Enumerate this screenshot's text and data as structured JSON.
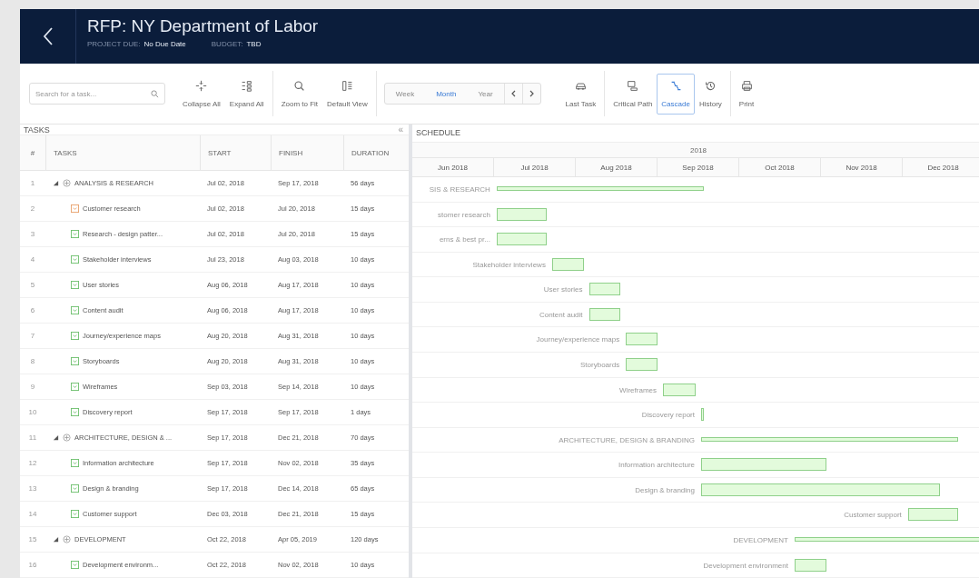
{
  "header": {
    "title": "RFP: NY Department of Labor",
    "fields": [
      {
        "label": "PROJECT DUE:",
        "value": "No Due Date"
      },
      {
        "label": "BUDGET:",
        "value": "TBD"
      }
    ]
  },
  "toolbar": {
    "search": {
      "placeholder": "Search for a task..."
    },
    "left_groups": [
      {
        "buttons": [
          {
            "label": "Collapse All",
            "kind": "collapse",
            "selected": false
          },
          {
            "label": "Expand All",
            "kind": "expand",
            "selected": false
          }
        ]
      },
      {
        "buttons": [
          {
            "label": "Zoom to Fit",
            "kind": "zoom",
            "selected": false
          },
          {
            "label": "Default View",
            "kind": "columns",
            "selected": false
          }
        ]
      }
    ],
    "view_switch": [
      {
        "label": "Week",
        "selected": false
      },
      {
        "label": "Month",
        "selected": true
      },
      {
        "label": "Year",
        "selected": false
      }
    ],
    "right_groups": [
      {
        "buttons": [
          {
            "label": "Last Task",
            "kind": "last",
            "selected": false
          }
        ]
      },
      {
        "buttons": [
          {
            "label": "Critical Path",
            "kind": "critical",
            "selected": false
          },
          {
            "label": "Cascade",
            "kind": "cascade",
            "selected": true
          },
          {
            "label": "History",
            "kind": "history",
            "selected": false
          }
        ]
      },
      {
        "buttons": [
          {
            "label": "Print",
            "kind": "print",
            "selected": false
          }
        ]
      }
    ]
  },
  "tasks": {
    "title": "TASKS",
    "collapse": "«",
    "columns": [
      "#",
      "TASKS",
      "START",
      "FINISH",
      "DURATION"
    ],
    "rows": [
      {
        "number": "1",
        "name": "ANALYSIS & RESEARCH",
        "start": "Jul 02, 2018",
        "finish": "Sep 17, 2018",
        "duration": "56 days",
        "expanded": true,
        "children": [
          {
            "number": "2",
            "name": "Customer research",
            "start": "Jul 02, 2018",
            "finish": "Jul 20, 2018",
            "duration": "15 days",
            "color": "#e8a06a"
          },
          {
            "number": "3",
            "name": "Research - design patter...",
            "start": "Jul 02, 2018",
            "finish": "Jul 20, 2018",
            "duration": "15 days",
            "color": "#6cbf6c"
          },
          {
            "number": "4",
            "name": "Stakeholder interviews",
            "start": "Jul 23, 2018",
            "finish": "Aug 03, 2018",
            "duration": "10 days",
            "color": "#6cbf6c"
          },
          {
            "number": "5",
            "name": "User stories",
            "start": "Aug 06, 2018",
            "finish": "Aug 17, 2018",
            "duration": "10 days",
            "color": "#6cbf6c"
          },
          {
            "number": "6",
            "name": "Content audit",
            "start": "Aug 06, 2018",
            "finish": "Aug 17, 2018",
            "duration": "10 days",
            "color": "#6cbf6c"
          },
          {
            "number": "7",
            "name": "Journey/experience maps",
            "start": "Aug 20, 2018",
            "finish": "Aug 31, 2018",
            "duration": "10 days",
            "color": "#6cbf6c"
          },
          {
            "number": "8",
            "name": "Storyboards",
            "start": "Aug 20, 2018",
            "finish": "Aug 31, 2018",
            "duration": "10 days",
            "color": "#6cbf6c"
          },
          {
            "number": "9",
            "name": "Wireframes",
            "start": "Sep 03, 2018",
            "finish": "Sep 14, 2018",
            "duration": "10 days",
            "color": "#6cbf6c"
          },
          {
            "number": "10",
            "name": "Discovery report",
            "start": "Sep 17, 2018",
            "finish": "Sep 17, 2018",
            "duration": "1 days",
            "color": "#6cbf6c"
          }
        ]
      },
      {
        "number": "11",
        "name": "ARCHITECTURE, DESIGN & ...",
        "start": "Sep 17, 2018",
        "finish": "Dec 21, 2018",
        "duration": "70 days",
        "expanded": true,
        "children": [
          {
            "number": "12",
            "name": "Information architecture",
            "start": "Sep 17, 2018",
            "finish": "Nov 02, 2018",
            "duration": "35 days",
            "color": "#6cbf6c"
          },
          {
            "number": "13",
            "name": "Design & branding",
            "start": "Sep 17, 2018",
            "finish": "Dec 14, 2018",
            "duration": "65 days",
            "color": "#6cbf6c"
          },
          {
            "number": "14",
            "name": "Customer support",
            "start": "Dec 03, 2018",
            "finish": "Dec 21, 2018",
            "duration": "15 days",
            "color": "#6cbf6c"
          }
        ]
      },
      {
        "number": "15",
        "name": "DEVELOPMENT",
        "start": "Oct 22, 2018",
        "finish": "Apr 05, 2019",
        "duration": "120 days",
        "expanded": true,
        "children": [
          {
            "number": "16",
            "name": "Development environm...",
            "start": "Oct 22, 2018",
            "finish": "Nov 02, 2018",
            "duration": "10 days",
            "color": "#6cbf6c"
          }
        ]
      }
    ]
  },
  "schedule": {
    "title": "SCHEDULE",
    "year": "2018",
    "months": [
      "Jun 2018",
      "Jul 2018",
      "Aug 2018",
      "Sep 2018",
      "Oct 2018",
      "Nov 2018",
      "Dec 2018"
    ],
    "bar_labels": [
      "SIS & RESEARCH",
      "stomer research",
      "erns & best pr...",
      "Stakeholder interviews",
      "User stories",
      "Content audit",
      "Journey/experience maps",
      "Storyboards",
      "Wireframes",
      "Discovery report",
      "ARCHITECTURE, DESIGN & BRANDING",
      "Information architecture",
      "Design & branding",
      "Customer support",
      "DEVELOPMENT",
      "Development environment"
    ]
  }
}
